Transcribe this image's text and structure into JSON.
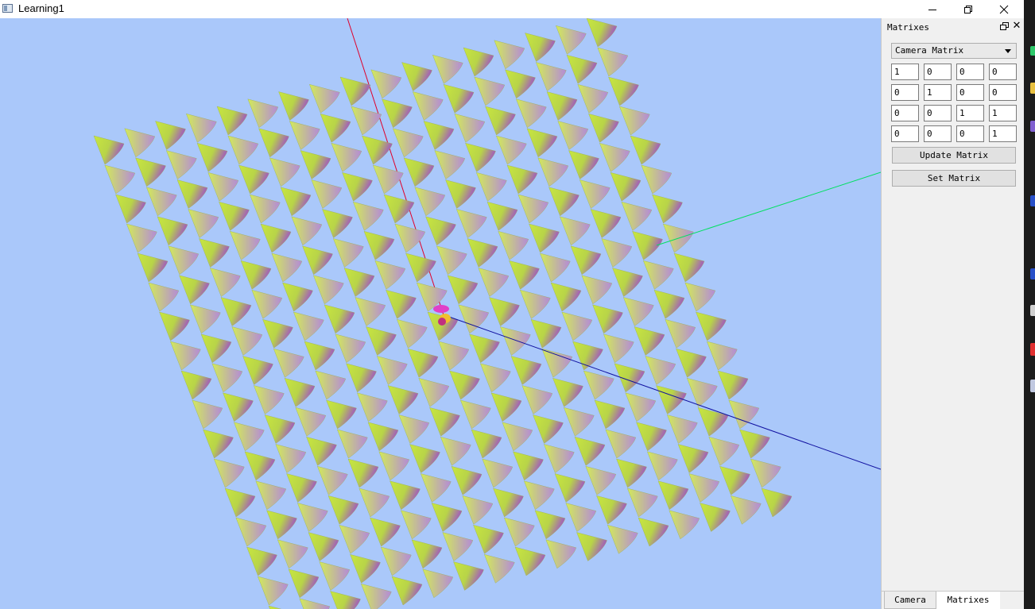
{
  "window": {
    "title": "Learning1"
  },
  "colors": {
    "viewport_bg": "#aac8fa",
    "cone_light": "#c8e640",
    "cone_dark": "#a050c8",
    "axis_x": "#e0002a",
    "axis_y": "#00e060",
    "axis_z": "#1010a0"
  },
  "dock": {
    "title": "Matrixes",
    "float_icon": "float-icon",
    "close_icon": "close-icon",
    "select": {
      "selected": "Camera Matrix",
      "icon": "chevron-down-icon"
    },
    "matrix": [
      [
        "1",
        "0",
        "0",
        "0"
      ],
      [
        "0",
        "1",
        "0",
        "0"
      ],
      [
        "0",
        "0",
        "1",
        "1"
      ],
      [
        "0",
        "0",
        "0",
        "1"
      ]
    ],
    "update_button": "Update Matrix",
    "set_button": "Set Matrix",
    "tabs": [
      "Camera",
      "Matrixes"
    ],
    "active_tab": "Matrixes"
  }
}
